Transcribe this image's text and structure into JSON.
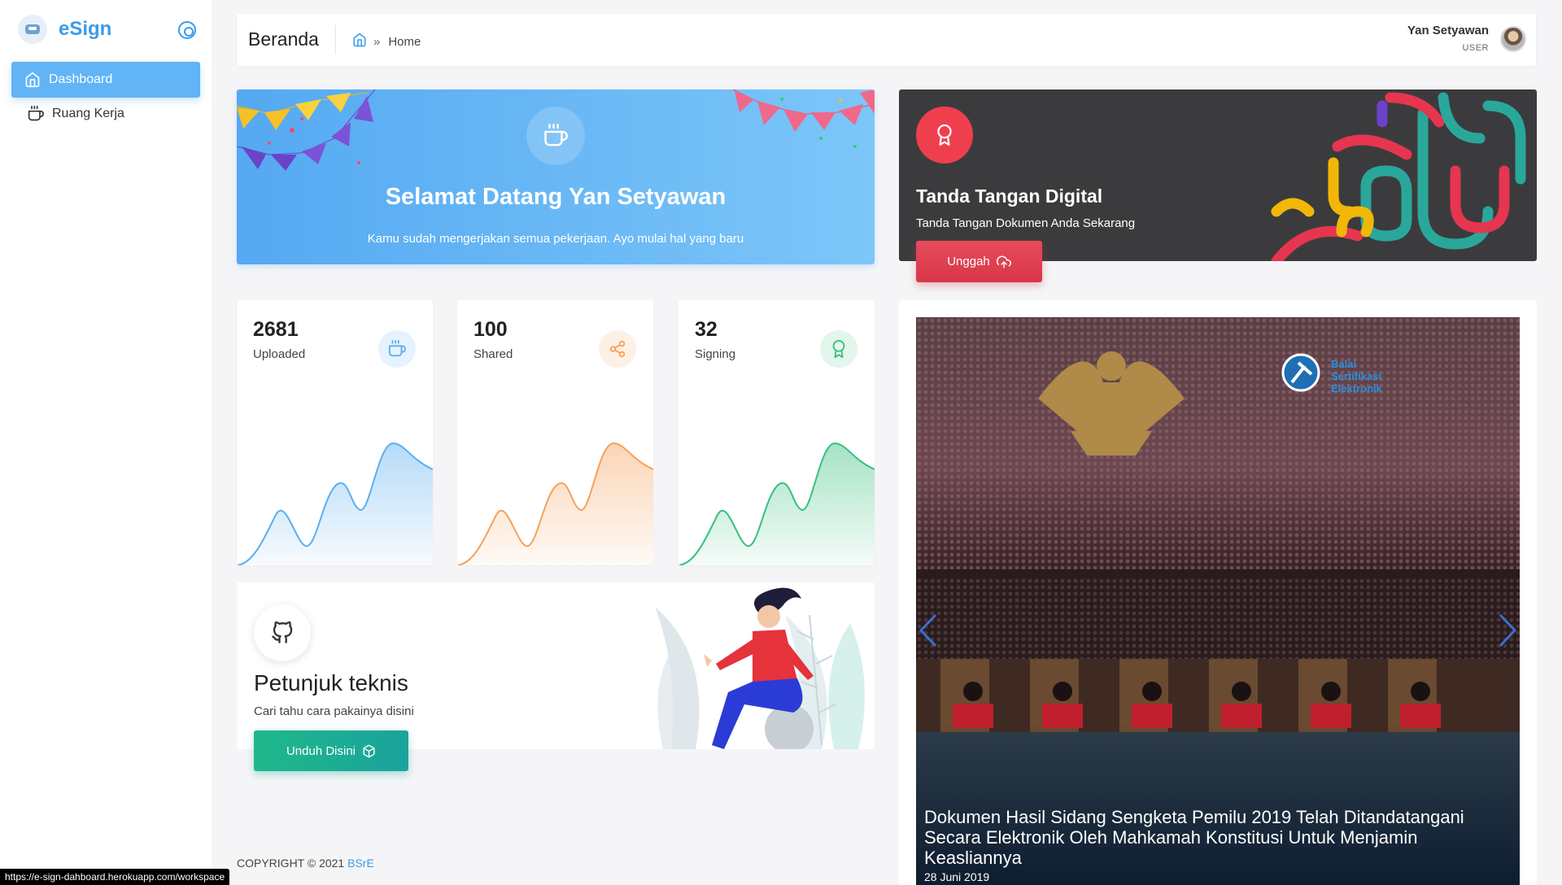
{
  "sidebar": {
    "brand": "eSign",
    "items": [
      {
        "label": "Dashboard",
        "icon": "home-icon",
        "active": true
      },
      {
        "label": "Ruang Kerja",
        "icon": "coffee-icon",
        "active": false
      }
    ]
  },
  "header": {
    "title": "Beranda",
    "breadcrumb": "Home",
    "user_name": "Yan Setyawan",
    "user_role": "USER"
  },
  "welcome": {
    "title": "Selamat Datang Yan Setyawan",
    "subtitle": "Kamu sudah mengerjakan semua pekerjaan. Ayo mulai hal yang baru"
  },
  "sign_card": {
    "title": "Tanda Tangan Digital",
    "subtitle": "Tanda Tangan Dokumen Anda Sekarang",
    "button": "Unggah"
  },
  "stats": [
    {
      "value": "2681",
      "label": "Uploaded",
      "color": "#5aaef0",
      "icon": "coffee-icon"
    },
    {
      "value": "100",
      "label": "Shared",
      "color": "#f5a15a",
      "icon": "share-icon"
    },
    {
      "value": "32",
      "label": "Signing",
      "color": "#35c07d",
      "icon": "award-icon"
    }
  ],
  "guide": {
    "title": "Petunjuk teknis",
    "subtitle": "Cari tahu cara pakainya disini",
    "button": "Unduh Disini"
  },
  "news": {
    "caption": "Dokumen Hasil Sidang Sengketa Pemilu 2019 Telah Ditandatangani Secara Elektronik Oleh Mahkamah Konstitusi Untuk Menjamin Keasliannya",
    "date": "28 Juni 2019",
    "logo_text": "Balai Sertifikasi Elektronik"
  },
  "footer": {
    "copyright": "COPYRIGHT © 2021 ",
    "link": "BSrE"
  },
  "status_url": "https://e-sign-dahboard.herokuapp.com/workspace"
}
